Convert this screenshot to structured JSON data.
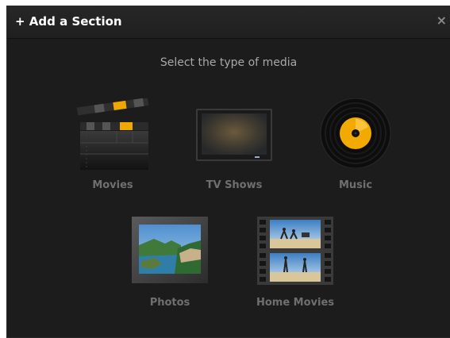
{
  "dialog": {
    "title": "+ Add a Section",
    "close_glyph": "×",
    "heading": "Select the type of media"
  },
  "media_types": [
    {
      "label": "Movies",
      "icon": "clapperboard-icon"
    },
    {
      "label": "TV Shows",
      "icon": "television-icon"
    },
    {
      "label": "Music",
      "icon": "vinyl-record-icon"
    },
    {
      "label": "Photos",
      "icon": "photo-icon"
    },
    {
      "label": "Home Movies",
      "icon": "film-strip-icon"
    }
  ],
  "colors": {
    "background": "#1c1c1c",
    "title_text": "#ffffff",
    "label_text": "#6f6f6f",
    "accent_yellow": "#f0a800"
  }
}
